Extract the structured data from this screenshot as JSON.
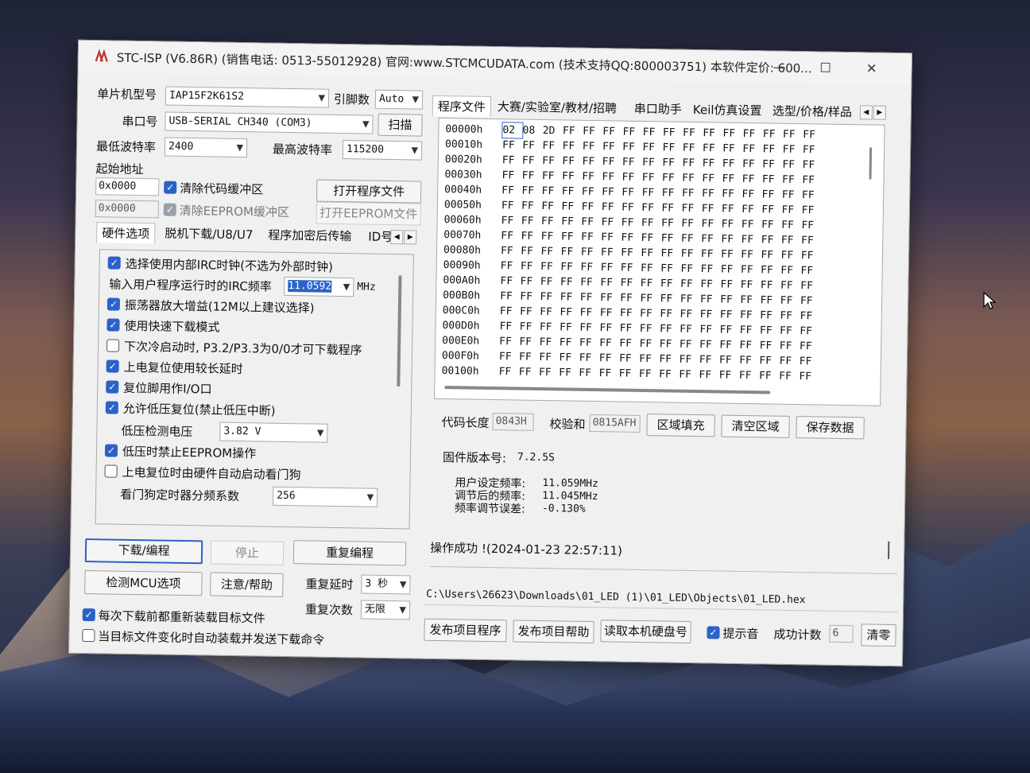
{
  "window": {
    "title": "STC-ISP (V6.86R) (销售电话: 0513-55012928) 官网:www.STCMCUDATA.com  (技术支持QQ:800003751) 本软件定价: 600...",
    "minimize": "—",
    "maximize": "☐",
    "close": "✕"
  },
  "config": {
    "mcu_label": "单片机型号",
    "mcu_value": "IAP15F2K61S2",
    "pin_label": "引脚数",
    "pin_value": "Auto",
    "port_label": "串口号",
    "port_value": "USB-SERIAL CH340 (COM3)",
    "scan_button": "扫描",
    "min_baud_label": "最低波特率",
    "min_baud_value": "2400",
    "max_baud_label": "最高波特率",
    "max_baud_value": "115200",
    "start_addr_label": "起始地址",
    "addr1": "0x0000",
    "clear_code_label": "清除代码缓冲区",
    "open_prog_button": "打开程序文件",
    "addr2": "0x0000",
    "clear_eeprom_label": "清除EEPROM缓冲区",
    "open_eeprom_button": "打开EEPROM文件"
  },
  "left_tabs": [
    "硬件选项",
    "脱机下载/U8/U7",
    "程序加密后传输",
    "ID号"
  ],
  "hardware": {
    "irc_label": "选择使用内部IRC时钟(不选为外部时钟)",
    "irc_freq_label": "输入用户程序运行时的IRC频率",
    "irc_freq_value": "11.0592",
    "irc_freq_unit": "MHz",
    "osc_gain_label": "振荡器放大增益(12M以上建议选择)",
    "fast_dl_label": "使用快速下载模式",
    "cold_start_label": "下次冷启动时, P3.2/P3.3为0/0才可下载程序",
    "long_delay_label": "上电复位使用较长延时",
    "reset_io_label": "复位脚用作I/O口",
    "lvr_label": "允许低压复位(禁止低压中断)",
    "lv_detect_label": "低压检测电压",
    "lv_detect_value": "3.82 V",
    "lv_eeprom_label": "低压时禁止EEPROM操作",
    "wdt_label": "上电复位时由硬件自动启动看门狗",
    "wdt_div_label": "看门狗定时器分频系数",
    "wdt_div_value": "256"
  },
  "actions": {
    "download": "下载/编程",
    "stop": "停止",
    "reprogram": "重复编程",
    "detect_mcu": "检测MCU选项",
    "help": "注意/帮助",
    "repeat_delay_label": "重复延时",
    "repeat_delay_value": "3 秒",
    "repeat_count_label": "重复次数",
    "repeat_count_value": "无限",
    "reload_label": "每次下载前都重新装载目标文件",
    "auto_send_label": "当目标文件变化时自动装载并发送下载命令"
  },
  "right_tabs": [
    "程序文件",
    "大赛/实验室/教材/招聘",
    "串口助手",
    "Keil仿真设置",
    "选型/价格/样品"
  ],
  "hex": {
    "rows": [
      {
        "addr": "00000h",
        "bytes": [
          "02",
          "08",
          "2D",
          "FF",
          "FF",
          "FF",
          "FF",
          "FF",
          "FF",
          "FF",
          "FF",
          "FF",
          "FF",
          "FF",
          "FF",
          "FF"
        ]
      },
      {
        "addr": "00010h",
        "bytes": [
          "FF",
          "FF",
          "FF",
          "FF",
          "FF",
          "FF",
          "FF",
          "FF",
          "FF",
          "FF",
          "FF",
          "FF",
          "FF",
          "FF",
          "FF",
          "FF"
        ]
      },
      {
        "addr": "00020h",
        "bytes": [
          "FF",
          "FF",
          "FF",
          "FF",
          "FF",
          "FF",
          "FF",
          "FF",
          "FF",
          "FF",
          "FF",
          "FF",
          "FF",
          "FF",
          "FF",
          "FF"
        ]
      },
      {
        "addr": "00030h",
        "bytes": [
          "FF",
          "FF",
          "FF",
          "FF",
          "FF",
          "FF",
          "FF",
          "FF",
          "FF",
          "FF",
          "FF",
          "FF",
          "FF",
          "FF",
          "FF",
          "FF"
        ]
      },
      {
        "addr": "00040h",
        "bytes": [
          "FF",
          "FF",
          "FF",
          "FF",
          "FF",
          "FF",
          "FF",
          "FF",
          "FF",
          "FF",
          "FF",
          "FF",
          "FF",
          "FF",
          "FF",
          "FF"
        ]
      },
      {
        "addr": "00050h",
        "bytes": [
          "FF",
          "FF",
          "FF",
          "FF",
          "FF",
          "FF",
          "FF",
          "FF",
          "FF",
          "FF",
          "FF",
          "FF",
          "FF",
          "FF",
          "FF",
          "FF"
        ]
      },
      {
        "addr": "00060h",
        "bytes": [
          "FF",
          "FF",
          "FF",
          "FF",
          "FF",
          "FF",
          "FF",
          "FF",
          "FF",
          "FF",
          "FF",
          "FF",
          "FF",
          "FF",
          "FF",
          "FF"
        ]
      },
      {
        "addr": "00070h",
        "bytes": [
          "FF",
          "FF",
          "FF",
          "FF",
          "FF",
          "FF",
          "FF",
          "FF",
          "FF",
          "FF",
          "FF",
          "FF",
          "FF",
          "FF",
          "FF",
          "FF"
        ]
      },
      {
        "addr": "00080h",
        "bytes": [
          "FF",
          "FF",
          "FF",
          "FF",
          "FF",
          "FF",
          "FF",
          "FF",
          "FF",
          "FF",
          "FF",
          "FF",
          "FF",
          "FF",
          "FF",
          "FF"
        ]
      },
      {
        "addr": "00090h",
        "bytes": [
          "FF",
          "FF",
          "FF",
          "FF",
          "FF",
          "FF",
          "FF",
          "FF",
          "FF",
          "FF",
          "FF",
          "FF",
          "FF",
          "FF",
          "FF",
          "FF"
        ]
      },
      {
        "addr": "000A0h",
        "bytes": [
          "FF",
          "FF",
          "FF",
          "FF",
          "FF",
          "FF",
          "FF",
          "FF",
          "FF",
          "FF",
          "FF",
          "FF",
          "FF",
          "FF",
          "FF",
          "FF"
        ]
      },
      {
        "addr": "000B0h",
        "bytes": [
          "FF",
          "FF",
          "FF",
          "FF",
          "FF",
          "FF",
          "FF",
          "FF",
          "FF",
          "FF",
          "FF",
          "FF",
          "FF",
          "FF",
          "FF",
          "FF"
        ]
      },
      {
        "addr": "000C0h",
        "bytes": [
          "FF",
          "FF",
          "FF",
          "FF",
          "FF",
          "FF",
          "FF",
          "FF",
          "FF",
          "FF",
          "FF",
          "FF",
          "FF",
          "FF",
          "FF",
          "FF"
        ]
      },
      {
        "addr": "000D0h",
        "bytes": [
          "FF",
          "FF",
          "FF",
          "FF",
          "FF",
          "FF",
          "FF",
          "FF",
          "FF",
          "FF",
          "FF",
          "FF",
          "FF",
          "FF",
          "FF",
          "FF"
        ]
      },
      {
        "addr": "000E0h",
        "bytes": [
          "FF",
          "FF",
          "FF",
          "FF",
          "FF",
          "FF",
          "FF",
          "FF",
          "FF",
          "FF",
          "FF",
          "FF",
          "FF",
          "FF",
          "FF",
          "FF"
        ]
      },
      {
        "addr": "000F0h",
        "bytes": [
          "FF",
          "FF",
          "FF",
          "FF",
          "FF",
          "FF",
          "FF",
          "FF",
          "FF",
          "FF",
          "FF",
          "FF",
          "FF",
          "FF",
          "FF",
          "FF"
        ]
      },
      {
        "addr": "00100h",
        "bytes": [
          "FF",
          "FF",
          "FF",
          "FF",
          "FF",
          "FF",
          "FF",
          "FF",
          "FF",
          "FF",
          "FF",
          "FF",
          "FF",
          "FF",
          "FF",
          "FF"
        ]
      }
    ],
    "code_len_label": "代码长度",
    "code_len_value": "0843H",
    "checksum_label": "校验和",
    "checksum_value": "0815AFH",
    "fill_button": "区域填充",
    "clear_button": "清空区域",
    "save_button": "保存数据"
  },
  "log": {
    "fw_label": "固件版本号:",
    "fw_value": "7.2.5S",
    "user_freq_label": "用户设定频率:",
    "user_freq_value": "11.059MHz",
    "adj_freq_label": "调节后的频率:",
    "adj_freq_value": "11.045MHz",
    "err_label": "频率调节误差:",
    "err_value": "-0.130%",
    "status": "操作成功 !(2024-01-23 22:57:11)"
  },
  "path": "C:\\Users\\26623\\Downloads\\01_LED (1)\\01_LED\\Objects\\01_LED.hex",
  "footer": {
    "publish_prog": "发布项目程序",
    "publish_help": "发布项目帮助",
    "read_hdd": "读取本机硬盘号",
    "beep_label": "提示音",
    "success_label": "成功计数",
    "success_value": "6",
    "clear_button": "清零"
  }
}
